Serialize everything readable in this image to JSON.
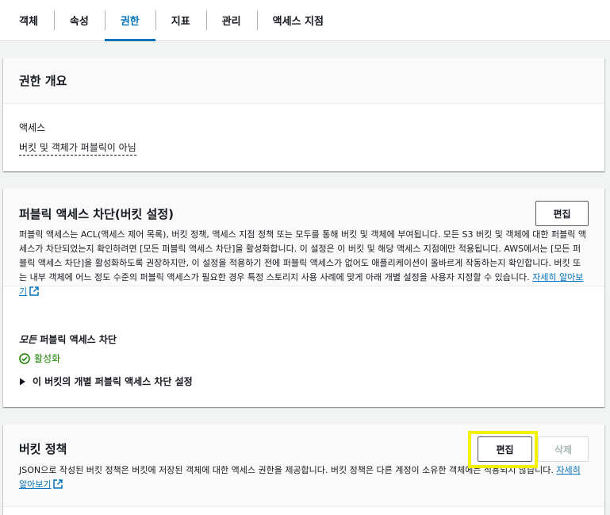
{
  "tabs": [
    {
      "label": "객체",
      "active": false
    },
    {
      "label": "속성",
      "active": false
    },
    {
      "label": "권한",
      "active": true
    },
    {
      "label": "지표",
      "active": false
    },
    {
      "label": "관리",
      "active": false
    },
    {
      "label": "액세스 지점",
      "active": false
    }
  ],
  "overview": {
    "title": "권한 개요",
    "access_label": "액세스",
    "access_value": "버킷 및 객체가 퍼블릭이 아님"
  },
  "block_public_access": {
    "title": "퍼블릭 액세스 차단(버킷 설정)",
    "edit_label": "편집",
    "description": "퍼블릭 액세스는 ACL(액세스 제어 목록), 버킷 정책, 액세스 지점 정책 또는 모두를 통해 버킷 및 객체에 부여됩니다. 모든 S3 버킷 및 객체에 대한 퍼블릭 액세스가 차단되었는지 확인하려면 [모든 퍼블릭 액세스 차단]을 활성화합니다. 이 설정은 이 버킷 및 해당 액세스 지점에만 적용됩니다. AWS에서는 [모든 퍼블릭 액세스 차단]을 활성화하도록 권장하지만, 이 설정을 적용하기 전에 퍼블릭 액세스가 없어도 애플리케이션이 올바르게 작동하는지 확인합니다. 버킷 또는 내부 객체에 어느 정도 수준의 퍼블릭 액세스가 필요한 경우 특정 스토리지 사용 사례에 맞게 아래 개별 설정을 사용자 지정할 수 있습니다.",
    "learn_more": "자세히 알아보기",
    "setting_label_italic": "모든",
    "setting_label_rest": " 퍼블릭 액세스 차단",
    "status": "활성화",
    "expander_label": "이 버킷의 개별 퍼블릭 액세스 차단 설정"
  },
  "bucket_policy": {
    "title": "버킷 정책",
    "edit_label": "편집",
    "delete_label": "삭제",
    "description": "JSON으로 작성된 버킷 정책은 버킷에 저장된 객체에 대한 액세스 권한을 제공합니다. 버킷 정책은 다른 계정이 소유한 객체에는 적용되지 않습니다.",
    "learn_more": "자세히 알아보기"
  },
  "colors": {
    "accent": "#0073bb",
    "success": "#1d8102",
    "highlight": "#f2f200"
  }
}
